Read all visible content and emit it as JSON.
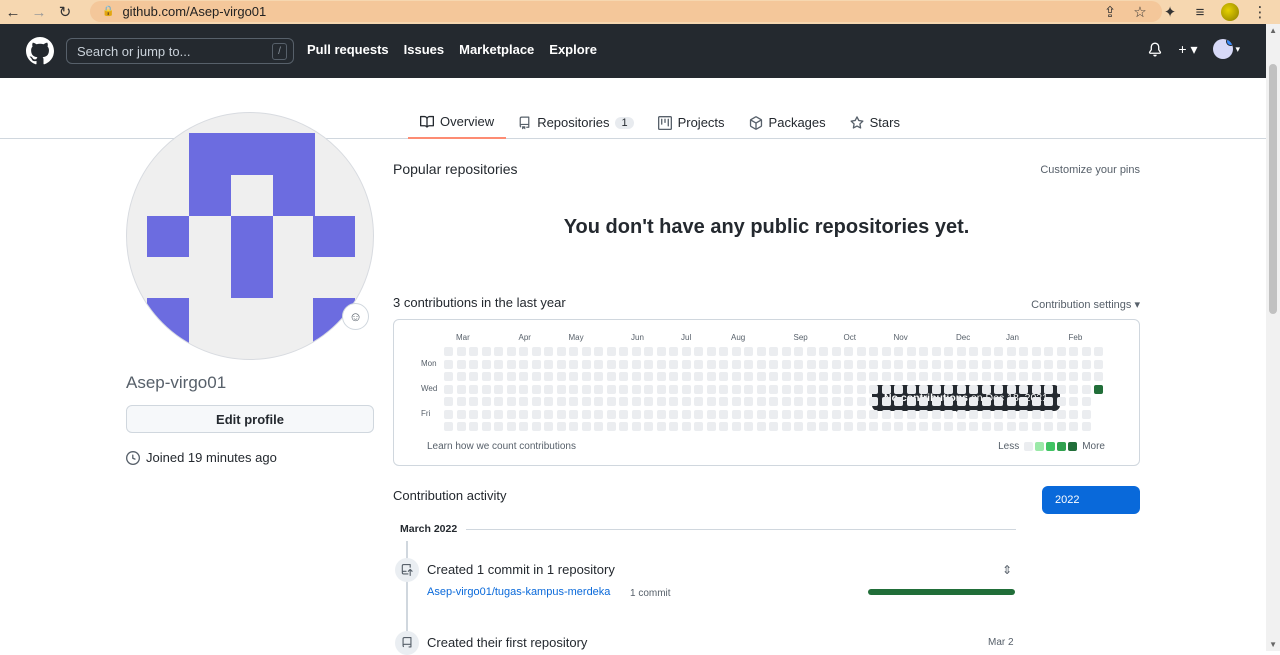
{
  "browser": {
    "url": "github.com/Asep-virgo01"
  },
  "header": {
    "search_placeholder": "Search or jump to...",
    "search_shortcut": "/",
    "nav": [
      "Pull requests",
      "Issues",
      "Marketplace",
      "Explore"
    ]
  },
  "tabs": [
    {
      "label": "Overview",
      "icon": "book-icon",
      "active": true
    },
    {
      "label": "Repositories",
      "icon": "repo-icon",
      "count": "1"
    },
    {
      "label": "Projects",
      "icon": "project-icon"
    },
    {
      "label": "Packages",
      "icon": "package-icon"
    },
    {
      "label": "Stars",
      "icon": "star-icon"
    }
  ],
  "profile": {
    "username": "Asep-virgo01",
    "edit_label": "Edit profile",
    "joined": "Joined 19 minutes ago",
    "identicon_color": "#6c6ce0"
  },
  "popular": {
    "title": "Popular repositories",
    "customize": "Customize your pins",
    "empty": "You don't have any public repositories yet."
  },
  "contributions": {
    "title": "3 contributions in the last year",
    "settings": "Contribution settings ▾",
    "months": [
      "Mar",
      "Apr",
      "May",
      "Jun",
      "Jul",
      "Aug",
      "Sep",
      "Oct",
      "Nov",
      "Dec",
      "Jan",
      "Feb"
    ],
    "days": [
      "Mon",
      "Wed",
      "Fri"
    ],
    "learn": "Learn how we count contributions",
    "legend_less": "Less",
    "legend_more": "More",
    "tooltip_bold": "No contributions",
    "tooltip_rest": " on Dec 18, 2021",
    "colors": [
      "#ebedf0",
      "#9be9a8",
      "#40c463",
      "#30a14e",
      "#216e39"
    ]
  },
  "activity": {
    "title": "Contribution activity",
    "year": "2022",
    "month": "March 2022",
    "item1": "Created 1 commit in 1 repository",
    "repo": "Asep-virgo01/tugas-kampus-merdeka",
    "commit_count": "1 commit",
    "progress": 1.0,
    "item2": "Created their first repository",
    "item2_date": "Mar 2"
  }
}
